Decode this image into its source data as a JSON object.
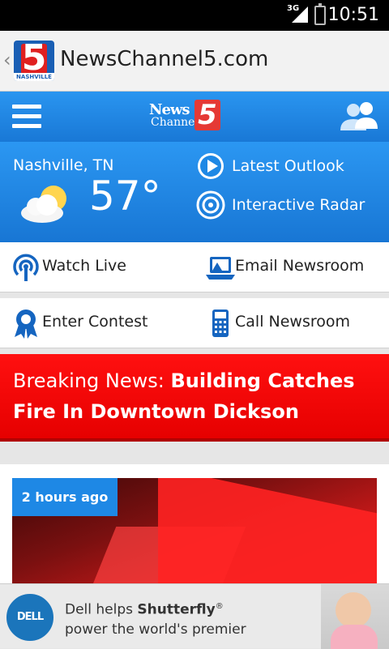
{
  "status_bar": {
    "network": "3G",
    "time": "10:51"
  },
  "app_bar": {
    "title": "NewsChannel5.com",
    "logo_number": "5",
    "logo_tag": "NASHVILLE"
  },
  "header": {
    "logo_line1": "News",
    "logo_line2": "Channel",
    "logo_number": "5"
  },
  "weather": {
    "city": "Nashville, TN",
    "temperature": "57°",
    "latest_outlook": "Latest Outlook",
    "interactive_radar": "Interactive Radar"
  },
  "quick_links": {
    "watch_live": "Watch Live",
    "email_newsroom": "Email Newsroom",
    "enter_contest": "Enter Contest",
    "call_newsroom": "Call Newsroom"
  },
  "breaking": {
    "prefix": "Breaking News: ",
    "headline": "Building Catches Fire In Downtown Dickson"
  },
  "story": {
    "age": "2 hours ago"
  },
  "ad": {
    "brand": "DELL",
    "line1_pre": "Dell helps ",
    "line1_bold": "Shutterfly",
    "line1_mark": "®",
    "line2": "power the world's premier"
  },
  "colors": {
    "brand_blue": "#1e88e5",
    "breaking_red": "#ff0000",
    "icon_blue": "#1565c0"
  }
}
